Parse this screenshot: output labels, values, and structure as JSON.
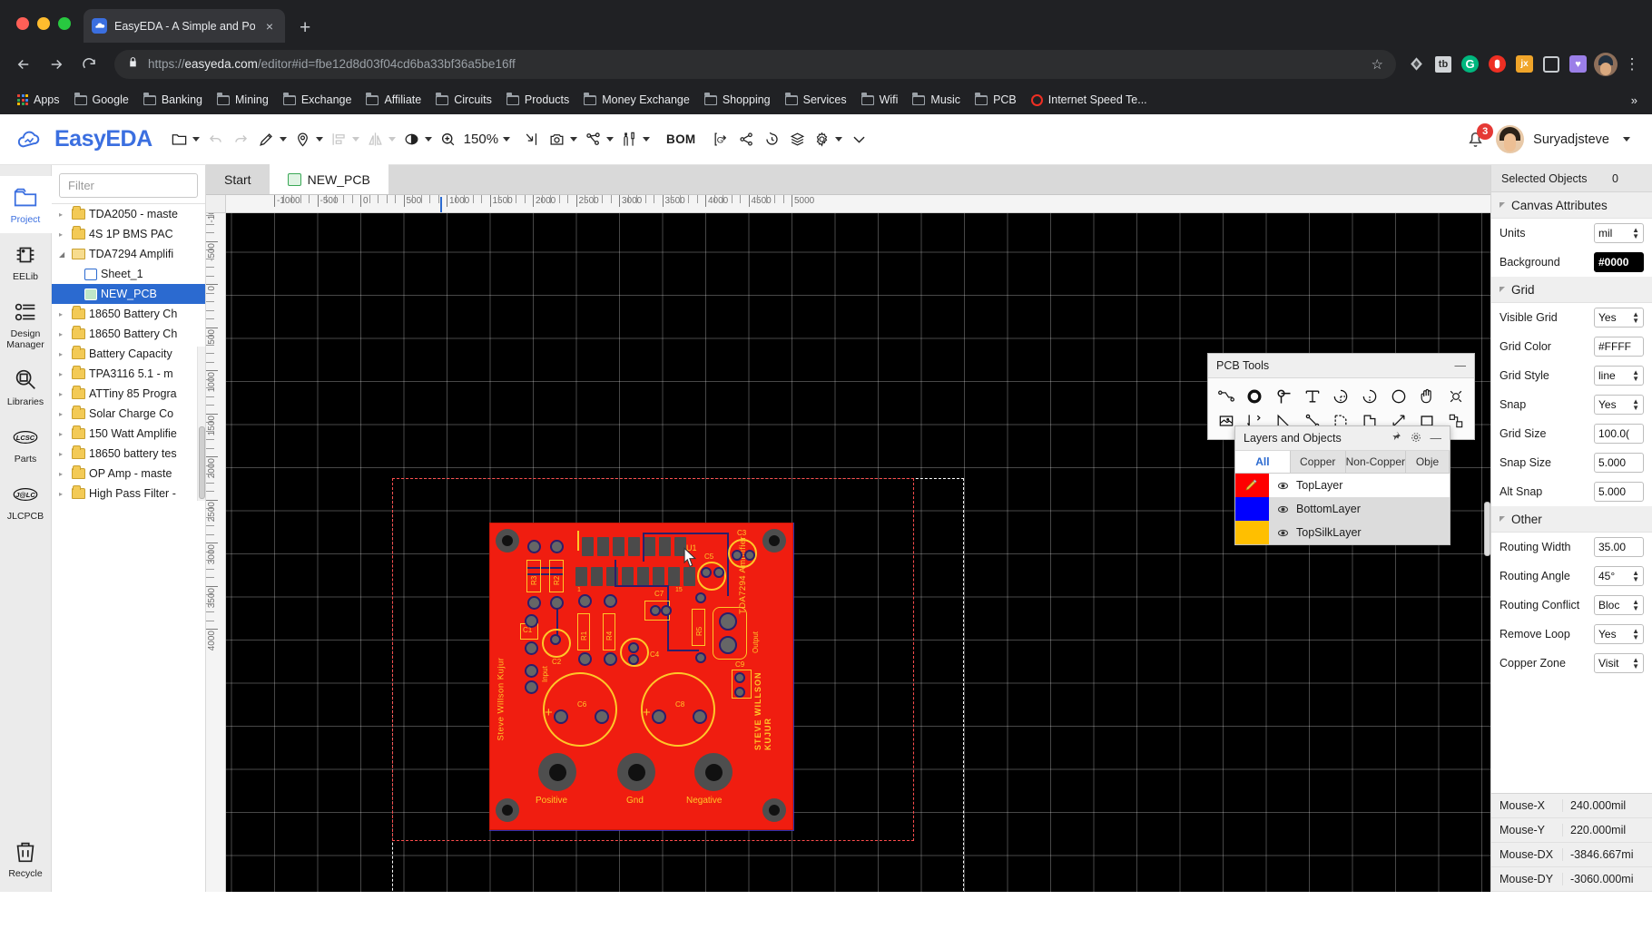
{
  "browser": {
    "tab_title": "EasyEDA - A Simple and Power",
    "tab_close": "×",
    "new_tab": "+",
    "url_scheme": "https://",
    "url_host": "easyeda.com",
    "url_path": "/editor#id=fbe12d8d03f04cd6ba33bf36a5be16ff",
    "star_icon": "☆",
    "kebab_icon": "⋮",
    "extensions": [
      {
        "name": "grammarly-lite-icon",
        "label": ""
      },
      {
        "name": "tubebuddy-icon",
        "label": "tb"
      },
      {
        "name": "grammarly-icon",
        "label": "G"
      },
      {
        "name": "opera-icon",
        "label": "●"
      },
      {
        "name": "jx-icon",
        "label": "jx"
      },
      {
        "name": "square-extension-icon",
        "label": ""
      },
      {
        "name": "pocket-icon",
        "label": "♥"
      }
    ],
    "bookmarks": [
      {
        "label": "Apps",
        "icon": "apps-grid-icon"
      },
      {
        "label": "Google",
        "icon": "folder-icon"
      },
      {
        "label": "Banking",
        "icon": "folder-icon"
      },
      {
        "label": "Mining",
        "icon": "folder-icon"
      },
      {
        "label": "Exchange",
        "icon": "folder-icon"
      },
      {
        "label": "Affiliate",
        "icon": "folder-icon"
      },
      {
        "label": "Circuits",
        "icon": "folder-icon"
      },
      {
        "label": "Products",
        "icon": "folder-icon"
      },
      {
        "label": "Money Exchange",
        "icon": "folder-icon"
      },
      {
        "label": "Shopping",
        "icon": "folder-icon"
      },
      {
        "label": "Services",
        "icon": "folder-icon"
      },
      {
        "label": "Wifi",
        "icon": "folder-icon"
      },
      {
        "label": "Music",
        "icon": "folder-icon"
      },
      {
        "label": "PCB",
        "icon": "folder-icon"
      },
      {
        "label": "Internet Speed Te...",
        "icon": "ring-icon"
      }
    ],
    "overflow": "»"
  },
  "app": {
    "brand": "EasyEDA",
    "zoom_level": "150%",
    "bom_label": "BOM",
    "username": "Suryadjsteve",
    "notification_count": "3",
    "toolbar_items": [
      {
        "name": "file-menu-button",
        "icon": "folder-icon",
        "has_caret": true,
        "disabled": false
      },
      {
        "name": "undo-button",
        "icon": "undo-icon",
        "has_caret": false,
        "disabled": true
      },
      {
        "name": "redo-button",
        "icon": "redo-icon",
        "has_caret": false,
        "disabled": true
      },
      {
        "name": "draw-tool-button",
        "icon": "pencil-icon",
        "has_caret": true,
        "disabled": false
      },
      {
        "name": "place-tool-button",
        "icon": "pin-icon",
        "has_caret": true,
        "disabled": false
      },
      {
        "name": "align-button",
        "icon": "align-icon",
        "has_caret": true,
        "disabled": true
      },
      {
        "name": "mirror-button",
        "icon": "flip-icon",
        "has_caret": true,
        "disabled": true
      },
      {
        "name": "visibility-button",
        "icon": "eye-icon",
        "has_caret": true,
        "disabled": false
      },
      {
        "name": "zoom-button",
        "icon": "zoom-in-icon",
        "has_caret": true,
        "disabled": false
      },
      {
        "name": "fit-button",
        "icon": "fit-arrow-icon",
        "has_caret": false,
        "disabled": false
      },
      {
        "name": "photo-view-button",
        "icon": "camera-icon",
        "has_caret": true,
        "disabled": false
      },
      {
        "name": "net-button",
        "icon": "net-icon",
        "has_caret": true,
        "disabled": false
      },
      {
        "name": "tools-button",
        "icon": "wrench-icon",
        "has_caret": true,
        "disabled": false
      },
      {
        "name": "bom-button",
        "icon": "bom-text",
        "has_caret": false,
        "disabled": false
      },
      {
        "name": "gerber-button",
        "icon": "gerber-icon",
        "has_caret": false,
        "disabled": false
      },
      {
        "name": "share-button",
        "icon": "share-icon",
        "has_caret": false,
        "disabled": false
      },
      {
        "name": "history-button",
        "icon": "history-icon",
        "has_caret": false,
        "disabled": false
      },
      {
        "name": "layers-button",
        "icon": "layers-icon",
        "has_caret": false,
        "disabled": false
      },
      {
        "name": "settings-button",
        "icon": "gear-icon",
        "has_caret": true,
        "disabled": false
      },
      {
        "name": "more-button",
        "icon": "chevron-down-icon",
        "has_caret": false,
        "disabled": false
      }
    ]
  },
  "rail": [
    {
      "label": "Project",
      "icon": "project-folder-icon",
      "active": true
    },
    {
      "label": "EELib",
      "icon": "chip-icon",
      "active": false
    },
    {
      "label": "Design Manager",
      "icon": "design-manager-icon",
      "active": false
    },
    {
      "label": "Libraries",
      "icon": "library-search-icon",
      "active": false
    },
    {
      "label": "Parts",
      "icon": "lcsc-icon",
      "active": false
    },
    {
      "label": "JLCPCB",
      "icon": "jlcpcb-icon",
      "active": false
    },
    {
      "label": "Recycle",
      "icon": "trash-icon",
      "active": false
    }
  ],
  "tree": {
    "filter_placeholder": "Filter",
    "items": [
      {
        "label": "TDA2050 - maste",
        "type": "folder",
        "arrow": "closed",
        "depth": 0,
        "selected": false
      },
      {
        "label": "4S 1P BMS PAC",
        "type": "folder",
        "arrow": "closed",
        "depth": 0,
        "selected": false
      },
      {
        "label": "TDA7294 Amplifi",
        "type": "folderopen",
        "arrow": "open",
        "depth": 0,
        "selected": false
      },
      {
        "label": "Sheet_1",
        "type": "sheet",
        "arrow": "none",
        "depth": 1,
        "selected": false
      },
      {
        "label": "NEW_PCB",
        "type": "pcb",
        "arrow": "none",
        "depth": 1,
        "selected": true
      },
      {
        "label": "18650 Battery Ch",
        "type": "folder",
        "arrow": "closed",
        "depth": 0,
        "selected": false
      },
      {
        "label": "18650 Battery Ch",
        "type": "folder",
        "arrow": "closed",
        "depth": 0,
        "selected": false
      },
      {
        "label": "Battery Capacity",
        "type": "folder",
        "arrow": "closed",
        "depth": 0,
        "selected": false
      },
      {
        "label": "TPA3116 5.1 - m",
        "type": "folder",
        "arrow": "closed",
        "depth": 0,
        "selected": false
      },
      {
        "label": "ATTiny 85 Progra",
        "type": "folder",
        "arrow": "closed",
        "depth": 0,
        "selected": false
      },
      {
        "label": "Solar Charge Co",
        "type": "folder",
        "arrow": "closed",
        "depth": 0,
        "selected": false
      },
      {
        "label": "150 Watt Amplifie",
        "type": "folder",
        "arrow": "closed",
        "depth": 0,
        "selected": false
      },
      {
        "label": "18650 battery tes",
        "type": "folder",
        "arrow": "closed",
        "depth": 0,
        "selected": false
      },
      {
        "label": "OP Amp - maste",
        "type": "folder",
        "arrow": "closed",
        "depth": 0,
        "selected": false
      },
      {
        "label": "High Pass Filter -",
        "type": "folder",
        "arrow": "closed",
        "depth": 0,
        "selected": false
      }
    ]
  },
  "doc_tabs": [
    {
      "label": "Start",
      "active": false,
      "icon": "none"
    },
    {
      "label": "NEW_PCB",
      "active": true,
      "icon": "pcb-icon"
    }
  ],
  "ruler": {
    "top_labels": [
      "-500",
      "0",
      "500",
      "1000",
      "1500",
      "2000",
      "2500",
      "3000",
      "3500",
      "4000"
    ],
    "left_labels": [
      "-500",
      "0",
      "500",
      "1000",
      "1500",
      "2000",
      "2500",
      "3000"
    ]
  },
  "pcb_tools": {
    "title": "PCB Tools",
    "minimize": "—",
    "row1": [
      "track-icon",
      "pad-icon",
      "via-icon",
      "text-icon",
      "arc-icon",
      "arc2-icon",
      "circle-icon",
      "hand-icon",
      "hole-icon"
    ],
    "row2": [
      "image-icon",
      "dimension-icon",
      "angle-icon",
      "line-icon",
      "copper-area-icon",
      "solid-region-icon",
      "measure-icon",
      "rect-icon",
      "panelize-icon"
    ]
  },
  "layers_panel": {
    "title": "Layers and Objects",
    "pin_icon": "pin-icon",
    "gear_icon": "gear-icon",
    "minimize": "—",
    "tabs": [
      {
        "label": "All",
        "active": true
      },
      {
        "label": "Copper",
        "active": false
      },
      {
        "label": "Non-Copper",
        "active": false
      },
      {
        "label": "Obje",
        "active": false
      }
    ],
    "layers": [
      {
        "name": "TopLayer",
        "color": "#ff0000",
        "visible": true,
        "active": true
      },
      {
        "name": "BottomLayer",
        "color": "#0000ff",
        "visible": true,
        "active": false
      },
      {
        "name": "TopSilkLayer",
        "color": "#ffbf00",
        "visible": true,
        "active": false
      }
    ]
  },
  "right_panel": {
    "selected_objects_label": "Selected Objects",
    "selected_objects_count": "0",
    "groups": [
      {
        "title": "Canvas Attributes",
        "rows": [
          {
            "label": "Units",
            "value": "mil",
            "type": "select"
          },
          {
            "label": "Background",
            "value": "#0000",
            "type": "color"
          }
        ]
      },
      {
        "title": "Grid",
        "rows": [
          {
            "label": "Visible Grid",
            "value": "Yes",
            "type": "select"
          },
          {
            "label": "Grid Color",
            "value": "#FFFF",
            "type": "text"
          },
          {
            "label": "Grid Style",
            "value": "line",
            "type": "select"
          },
          {
            "label": "Snap",
            "value": "Yes",
            "type": "select"
          },
          {
            "label": "Grid Size",
            "value": "100.0(",
            "type": "text"
          },
          {
            "label": "Snap Size",
            "value": "5.000",
            "type": "text"
          },
          {
            "label": "Alt Snap",
            "value": "5.000",
            "type": "text"
          }
        ]
      },
      {
        "title": "Other",
        "rows": [
          {
            "label": "Routing Width",
            "value": "35.00",
            "type": "text"
          },
          {
            "label": "Routing Angle",
            "value": "45°",
            "type": "select"
          },
          {
            "label": "Routing Conflict",
            "value": "Bloc",
            "type": "select"
          },
          {
            "label": "Remove Loop",
            "value": "Yes",
            "type": "select"
          },
          {
            "label": "Copper Zone",
            "value": "Visit",
            "type": "select"
          }
        ]
      }
    ],
    "mouse": [
      {
        "key": "Mouse-X",
        "value": "240.000mil"
      },
      {
        "key": "Mouse-Y",
        "value": "220.000mil"
      },
      {
        "key": "Mouse-DX",
        "value": "-3846.667mi"
      },
      {
        "key": "Mouse-DY",
        "value": "-3060.000mi"
      }
    ]
  },
  "board": {
    "designations": [
      "U1",
      "C3",
      "C5",
      "C7",
      "C9",
      "C1",
      "C2",
      "C4",
      "C6",
      "C8",
      "R1",
      "R2",
      "R3",
      "R4",
      "R5"
    ],
    "silkscreen_texts": [
      "Steve Willson Kujur",
      "TDA7294 Amplifier",
      "STEVE WILLSON KUJUR",
      "Input",
      "Output",
      "Positive",
      "Gnd",
      "Negative",
      "1",
      "15"
    ],
    "colors": {
      "soldermask": "#f01d10",
      "silk": "#ffc728",
      "toplayer": "#ff0000",
      "bottomlayer": "#2c1f6b",
      "pad": "#555555"
    }
  }
}
